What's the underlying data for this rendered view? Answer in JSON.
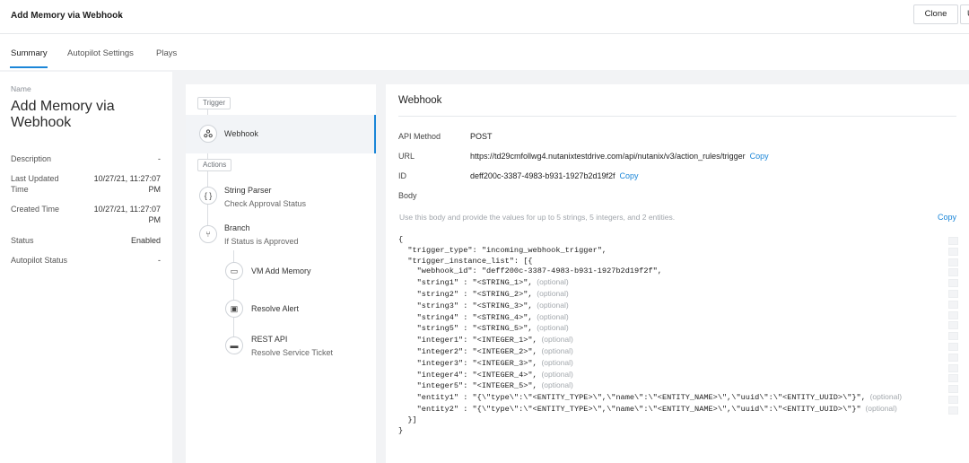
{
  "header": {
    "title": "Add Memory via Webhook",
    "clone_label": "Clone",
    "next_label": "U"
  },
  "tabs": [
    {
      "label": "Summary",
      "active": true
    },
    {
      "label": "Autopilot Settings",
      "active": false
    },
    {
      "label": "Plays",
      "active": false
    }
  ],
  "summary": {
    "name_label": "Name",
    "name": "Add Memory via Webhook",
    "fields": [
      {
        "key": "Description",
        "value": "-"
      },
      {
        "key": "Last Updated Time",
        "value": "10/27/21, 11:27:07 PM"
      },
      {
        "key": "Created Time",
        "value": "10/27/21, 11:27:07 PM"
      },
      {
        "key": "Status",
        "value": "Enabled"
      },
      {
        "key": "Autopilot Status",
        "value": "-"
      }
    ]
  },
  "flow": {
    "trigger_section": "Trigger",
    "actions_section": "Actions",
    "trigger": {
      "title": "Webhook",
      "icon": "webhook-icon"
    },
    "actions": [
      {
        "title": "String Parser",
        "subtitle": "Check Approval Status",
        "icon": "brackets-icon",
        "glyph": "{ }"
      },
      {
        "title": "Branch",
        "subtitle": "If Status is Approved",
        "icon": "branch-icon",
        "glyph": "⑂"
      }
    ],
    "branch_actions": [
      {
        "title": "VM Add Memory",
        "subtitle": "",
        "icon": "vm-icon",
        "glyph": "▭"
      },
      {
        "title": "Resolve Alert",
        "subtitle": "",
        "icon": "alert-clipboard-icon",
        "glyph": "▣"
      },
      {
        "title": "REST API",
        "subtitle": "Resolve Service Ticket",
        "icon": "rest-api-icon",
        "glyph": "▬"
      }
    ]
  },
  "webhook": {
    "title": "Webhook",
    "api_method_label": "API Method",
    "api_method": "POST",
    "url_label": "URL",
    "url": "https://td29cmfollwg4.nutanixtestdrive.com/api/nutanix/v3/action_rules/trigger",
    "id_label": "ID",
    "id": "deff200c-3387-4983-b931-1927b2d19f2f",
    "copy_label": "Copy",
    "body_label": "Body",
    "body_hint": "Use this body and provide the values for up to 5 strings, 5 integers, and 2 entities.",
    "optional_label": "(optional)",
    "body_lines": [
      {
        "text": "{",
        "optional": false
      },
      {
        "text": "  \"trigger_type\": \"incoming_webhook_trigger\",",
        "optional": false
      },
      {
        "text": "  \"trigger_instance_list\": [{",
        "optional": false
      },
      {
        "text": "    \"webhook_id\": \"deff200c-3387-4983-b931-1927b2d19f2f\",",
        "optional": false
      },
      {
        "text": "    \"string1\" : \"<STRING_1>\",",
        "optional": true
      },
      {
        "text": "    \"string2\" : \"<STRING_2>\",",
        "optional": true
      },
      {
        "text": "    \"string3\" : \"<STRING_3>\",",
        "optional": true
      },
      {
        "text": "    \"string4\" : \"<STRING_4>\",",
        "optional": true
      },
      {
        "text": "    \"string5\" : \"<STRING_5>\",",
        "optional": true
      },
      {
        "text": "    \"integer1\": \"<INTEGER_1>\",",
        "optional": true
      },
      {
        "text": "    \"integer2\": \"<INTEGER_2>\",",
        "optional": true
      },
      {
        "text": "    \"integer3\": \"<INTEGER_3>\",",
        "optional": true
      },
      {
        "text": "    \"integer4\": \"<INTEGER_4>\",",
        "optional": true
      },
      {
        "text": "    \"integer5\": \"<INTEGER_5>\",",
        "optional": true
      },
      {
        "text": "    \"entity1\" : \"{\\\"type\\\":\\\"<ENTITY_TYPE>\\\",\\\"name\\\":\\\"<ENTITY_NAME>\\\",\\\"uuid\\\":\\\"<ENTITY_UUID>\\\"}\",",
        "optional": true
      },
      {
        "text": "    \"entity2\" : \"{\\\"type\\\":\\\"<ENTITY_TYPE>\\\",\\\"name\\\":\\\"<ENTITY_NAME>\\\",\\\"uuid\\\":\\\"<ENTITY_UUID>\\\"}\"",
        "optional": true
      },
      {
        "text": "  }]",
        "optional": false
      },
      {
        "text": "}",
        "optional": false
      }
    ]
  },
  "colors": {
    "accent": "#1b86d8",
    "background": "#f2f3f5"
  }
}
